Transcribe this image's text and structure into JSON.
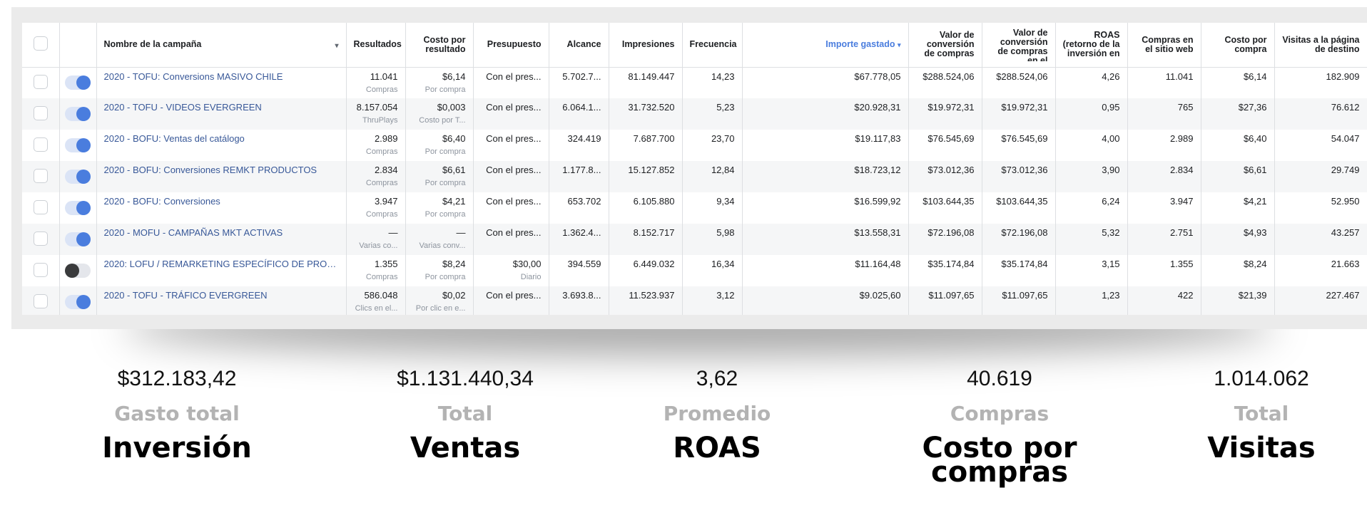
{
  "table": {
    "headers": {
      "name": "Nombre de la campaña",
      "results": "Resultados",
      "cost_per_result": "Costo por resultado",
      "budget": "Presupuesto",
      "reach": "Alcance",
      "impressions": "Impresiones",
      "frequency": "Frecuencia",
      "amount_spent": "Importe gastado",
      "conv_value": "Valor de conversión de compras",
      "conv_value_web": "Valor de conversión de compras en el",
      "roas": "ROAS (retorno de la inversión en",
      "web_purchases": "Compras en el sitio web",
      "cost_per_purchase": "Costo por compra",
      "landing_visits": "Visitas a la página de destino"
    },
    "rows": [
      {
        "active": true,
        "name": "2020 - TOFU: Conversions MASIVO CHILE",
        "results": "11.041",
        "results_sub": "Compras",
        "cpr": "$6,14",
        "cpr_sub": "Por compra",
        "budget": "Con el pres...",
        "budget_sub": "",
        "reach": "5.702.7...",
        "impressions": "81.149.447",
        "frequency": "14,23",
        "spent": "$67.778,05",
        "conv_value": "$288.524,06",
        "conv_value_web": "$288.524,06",
        "roas": "4,26",
        "web_purchases": "11.041",
        "cost_per_purchase": "$6,14",
        "visits": "182.909"
      },
      {
        "active": true,
        "name": "2020 - TOFU - VIDEOS EVERGREEN",
        "results": "8.157.054",
        "results_sub": "ThruPlays",
        "cpr": "$0,003",
        "cpr_sub": "Costo por T...",
        "budget": "Con el pres...",
        "budget_sub": "",
        "reach": "6.064.1...",
        "impressions": "31.732.520",
        "frequency": "5,23",
        "spent": "$20.928,31",
        "conv_value": "$19.972,31",
        "conv_value_web": "$19.972,31",
        "roas": "0,95",
        "web_purchases": "765",
        "cost_per_purchase": "$27,36",
        "visits": "76.612"
      },
      {
        "active": true,
        "name": "2020 - BOFU: Ventas del catálogo",
        "results": "2.989",
        "results_sub": "Compras",
        "cpr": "$6,40",
        "cpr_sub": "Por compra",
        "budget": "Con el pres...",
        "budget_sub": "",
        "reach": "324.419",
        "impressions": "7.687.700",
        "frequency": "23,70",
        "spent": "$19.117,83",
        "conv_value": "$76.545,69",
        "conv_value_web": "$76.545,69",
        "roas": "4,00",
        "web_purchases": "2.989",
        "cost_per_purchase": "$6,40",
        "visits": "54.047"
      },
      {
        "active": true,
        "name": "2020 - BOFU: Conversiones REMKT PRODUCTOS",
        "results": "2.834",
        "results_sub": "Compras",
        "cpr": "$6,61",
        "cpr_sub": "Por compra",
        "budget": "Con el pres...",
        "budget_sub": "",
        "reach": "1.177.8...",
        "impressions": "15.127.852",
        "frequency": "12,84",
        "spent": "$18.723,12",
        "conv_value": "$73.012,36",
        "conv_value_web": "$73.012,36",
        "roas": "3,90",
        "web_purchases": "2.834",
        "cost_per_purchase": "$6,61",
        "visits": "29.749"
      },
      {
        "active": true,
        "name": "2020 - BOFU: Conversiones",
        "results": "3.947",
        "results_sub": "Compras",
        "cpr": "$4,21",
        "cpr_sub": "Por compra",
        "budget": "Con el pres...",
        "budget_sub": "",
        "reach": "653.702",
        "impressions": "6.105.880",
        "frequency": "9,34",
        "spent": "$16.599,92",
        "conv_value": "$103.644,35",
        "conv_value_web": "$103.644,35",
        "roas": "6,24",
        "web_purchases": "3.947",
        "cost_per_purchase": "$4,21",
        "visits": "52.950"
      },
      {
        "active": true,
        "name": "2020 - MOFU - CAMPAÑAS MKT ACTIVAS",
        "results": "—",
        "results_sub": "Varias co...",
        "cpr": "—",
        "cpr_sub": "Varias conv...",
        "budget": "Con el pres...",
        "budget_sub": "",
        "reach": "1.362.4...",
        "impressions": "8.152.717",
        "frequency": "5,98",
        "spent": "$13.558,31",
        "conv_value": "$72.196,08",
        "conv_value_web": "$72.196,08",
        "roas": "5,32",
        "web_purchases": "2.751",
        "cost_per_purchase": "$4,93",
        "visits": "43.257"
      },
      {
        "active": false,
        "name": "2020: LOFU / REMARKETING ESPECÍFICO DE PROD...",
        "results": "1.355",
        "results_sub": "Compras",
        "cpr": "$8,24",
        "cpr_sub": "Por compra",
        "budget": "$30,00",
        "budget_sub": "Diario",
        "reach": "394.559",
        "impressions": "6.449.032",
        "frequency": "16,34",
        "spent": "$11.164,48",
        "conv_value": "$35.174,84",
        "conv_value_web": "$35.174,84",
        "roas": "3,15",
        "web_purchases": "1.355",
        "cost_per_purchase": "$8,24",
        "visits": "21.663"
      },
      {
        "active": true,
        "name": "2020 - TOFU - TRÁFICO EVERGREEN",
        "results": "586.048",
        "results_sub": "Clics en el...",
        "cpr": "$0,02",
        "cpr_sub": "Por clic en e...",
        "budget": "Con el pres...",
        "budget_sub": "",
        "reach": "3.693.8...",
        "impressions": "11.523.937",
        "frequency": "3,12",
        "spent": "$9.025,60",
        "conv_value": "$11.097,65",
        "conv_value_web": "$11.097,65",
        "roas": "1,23",
        "web_purchases": "422",
        "cost_per_purchase": "$21,39",
        "visits": "227.467"
      }
    ]
  },
  "summary": [
    {
      "value": "$312.183,42",
      "sublabel": "Gasto total",
      "label": "Inversión"
    },
    {
      "value": "$1.131.440,34",
      "sublabel": "Total",
      "label": "Ventas"
    },
    {
      "value": "3,62",
      "sublabel": "Promedio",
      "label": "ROAS"
    },
    {
      "value": "40.619",
      "sublabel": "Compras",
      "label": "Costo por compras"
    },
    {
      "value": "1.014.062",
      "sublabel": "Total",
      "label": "Visitas"
    }
  ],
  "colors": {
    "accent": "#4a7dde",
    "link": "#385898",
    "muted": "#b3b3b3"
  }
}
